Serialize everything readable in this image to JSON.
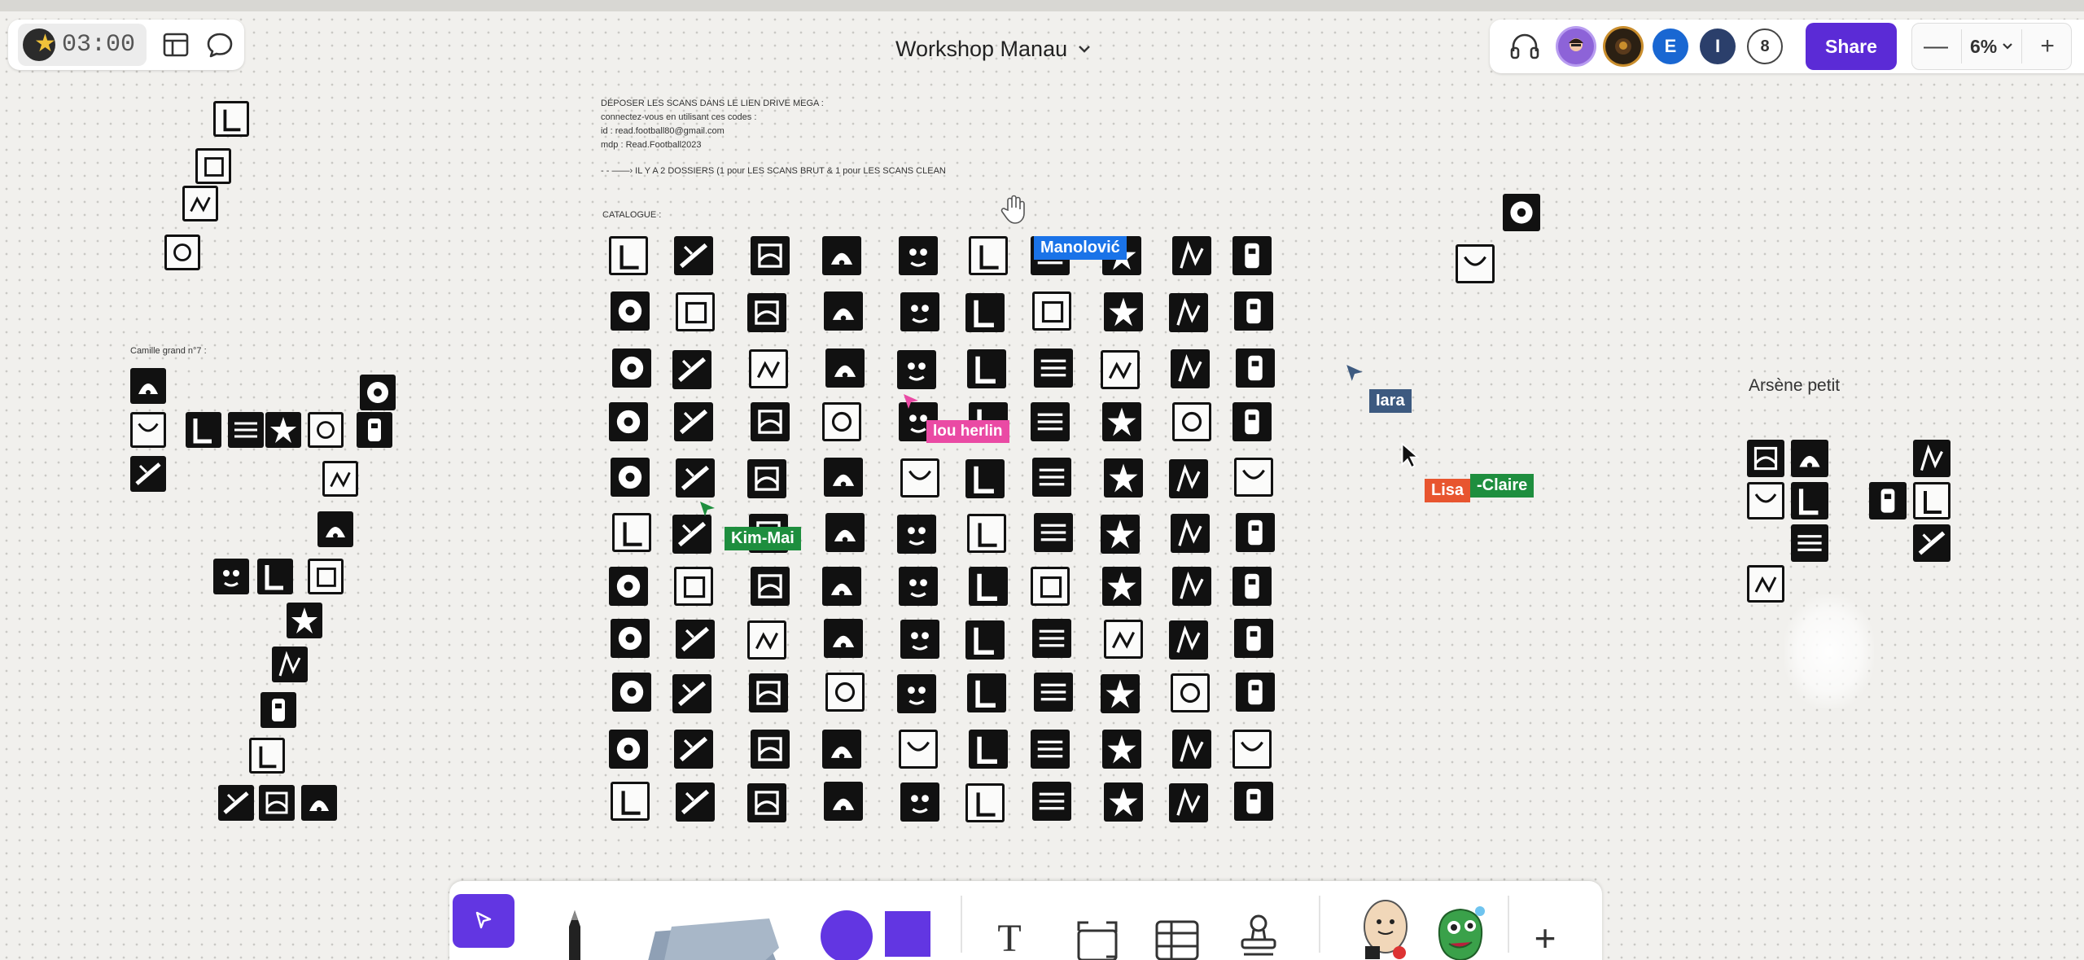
{
  "toolbar": {
    "timer": "03:00",
    "doc_title": "Workshop Manau",
    "collaborators": [
      {
        "label": "",
        "color": "#8d63d8",
        "kind": "photo"
      },
      {
        "label": "",
        "color": "#3b2a1a",
        "kind": "photo"
      },
      {
        "label": "E",
        "color": "#1967d2",
        "kind": "initial"
      },
      {
        "label": "I",
        "color": "#2b3f6b",
        "kind": "initial"
      }
    ],
    "collaborator_count": "8",
    "share_label": "Share",
    "zoom_value": "6%",
    "zoom_minus": "—",
    "zoom_plus": "+"
  },
  "canvas": {
    "instructions": [
      "DÉPOSER LES SCANS DANS LE LIEN DRIVE MEGA :",
      "connectez-vous en utilisant ces codes :",
      "id : read.football80@gmail.com",
      "mdp : Read.Football2023",
      "",
      "- - ——› IL Y A 2 DOSSIERS (1 pour LES SCANS BRUT & 1 pour LES SCANS CLEAN"
    ],
    "catalogue_label": "CATALOGUE :",
    "left_group_label": "Camille grand n°7 :",
    "right_group_label": "Arsène petit"
  },
  "cursors": [
    {
      "name": "Manolović",
      "color": "#1a73e8"
    },
    {
      "name": "lou herlin",
      "color": "#ea4aa4"
    },
    {
      "name": "Kim-Mai",
      "color": "#1e8e3e"
    },
    {
      "name": "Iara",
      "color": "#3d5a80"
    },
    {
      "name": "Lisa",
      "color": "#e8552f"
    },
    {
      "name": "-Claire",
      "color": "#1e8e3e"
    }
  ],
  "bottom_tools": {
    "text_tool": "T",
    "add_tool": "+"
  },
  "colors": {
    "accent": "#5b2bd6",
    "shape_purple": "#6236e2"
  },
  "icons": {
    "timer": "timer-logo-icon",
    "layout": "layout-icon",
    "comment": "comment-icon",
    "headphones": "headphones-icon",
    "chevron": "chevron-down-icon",
    "select": "select-arrow-icon",
    "pen": "pen-icon",
    "sticky": "sticky-note-icon",
    "shape_circle": "circle-shape-icon",
    "shape_square": "square-shape-icon",
    "section": "section-frame-icon",
    "table": "table-icon",
    "stamp": "stamp-icon",
    "sticker1": "sticker-egg-icon",
    "sticker2": "sticker-monster-icon"
  }
}
